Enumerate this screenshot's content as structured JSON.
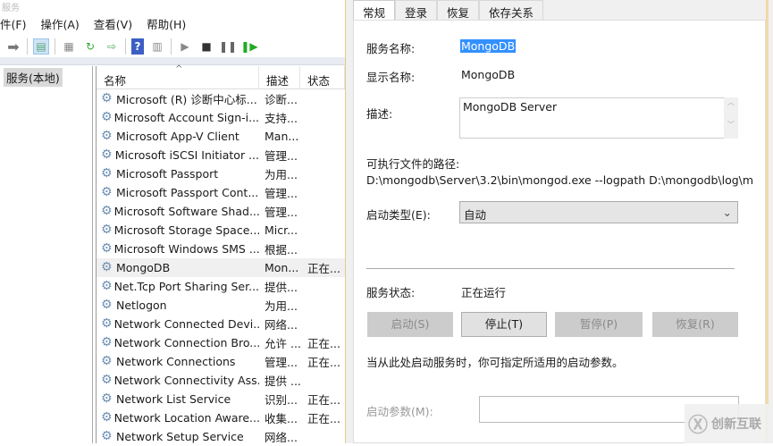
{
  "window": {
    "title": "服务"
  },
  "menu": [
    "件(F)",
    "操作(A)",
    "查看(V)",
    "帮助(H)"
  ],
  "tree": {
    "node": "服务(本地)"
  },
  "list": {
    "headers": {
      "name": "名称",
      "desc": "描述",
      "status": "状态"
    },
    "rows": [
      {
        "name": "Microsoft (R) 诊断中心标...",
        "desc": "诊断...",
        "status": ""
      },
      {
        "name": "Microsoft Account Sign-i...",
        "desc": "支持...",
        "status": ""
      },
      {
        "name": "Microsoft App-V Client",
        "desc": "Man...",
        "status": ""
      },
      {
        "name": "Microsoft iSCSI Initiator ...",
        "desc": "管理...",
        "status": ""
      },
      {
        "name": "Microsoft Passport",
        "desc": "为用...",
        "status": ""
      },
      {
        "name": "Microsoft Passport Cont...",
        "desc": "管理...",
        "status": ""
      },
      {
        "name": "Microsoft Software Shad...",
        "desc": "管理...",
        "status": ""
      },
      {
        "name": "Microsoft Storage Space...",
        "desc": "Micr...",
        "status": ""
      },
      {
        "name": "Microsoft Windows SMS ...",
        "desc": "根据...",
        "status": ""
      },
      {
        "name": "MongoDB",
        "desc": "Mon...",
        "status": "正在..."
      },
      {
        "name": "Net.Tcp Port Sharing Ser...",
        "desc": "提供...",
        "status": ""
      },
      {
        "name": "Netlogon",
        "desc": "为用...",
        "status": ""
      },
      {
        "name": "Network Connected Devi...",
        "desc": "网络...",
        "status": ""
      },
      {
        "name": "Network Connection Bro...",
        "desc": "允许 ...",
        "status": "正在..."
      },
      {
        "name": "Network Connections",
        "desc": "管理...",
        "status": "正在..."
      },
      {
        "name": "Network Connectivity Ass...",
        "desc": "提供 ...",
        "status": ""
      },
      {
        "name": "Network List Service",
        "desc": "识别...",
        "status": "正在..."
      },
      {
        "name": "Network Location Aware...",
        "desc": "收集...",
        "status": "正在..."
      },
      {
        "name": "Network Setup Service",
        "desc": "网络...",
        "status": ""
      }
    ]
  },
  "dialog": {
    "tabs": [
      "常规",
      "登录",
      "恢复",
      "依存关系"
    ],
    "service_name_label": "服务名称:",
    "service_name": "MongoDB",
    "display_name_label": "显示名称:",
    "display_name": "MongoDB",
    "desc_label": "描述:",
    "desc": "MongoDB Server",
    "path_label": "可执行文件的路径:",
    "path": "D:\\mongodb\\Server\\3.2\\bin\\mongod.exe --logpath D:\\mongodb\\log\\m",
    "startup_label": "启动类型(E):",
    "startup_value": "自动",
    "status_label": "服务状态:",
    "status_value": "正在运行",
    "buttons": {
      "start": "启动(S)",
      "stop": "停止(T)",
      "pause": "暂停(P)",
      "resume": "恢复(R)"
    },
    "hint": "当从此处启动服务时，你可指定所适用的启动参数。",
    "param_label": "启动参数(M):",
    "param_value": ""
  },
  "watermark": "创新互联"
}
